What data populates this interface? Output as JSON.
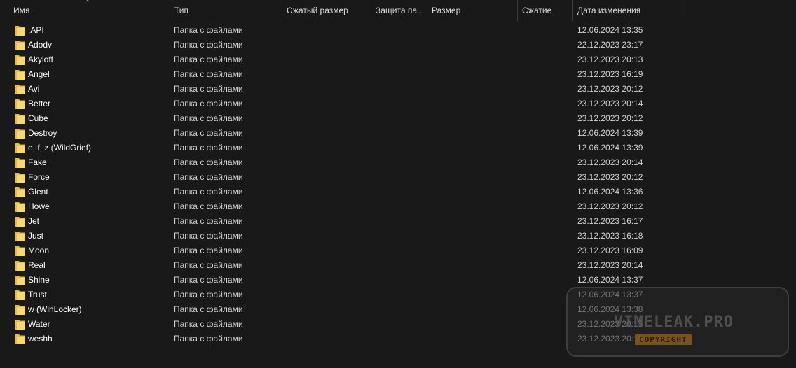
{
  "columns": {
    "name": "Имя",
    "type": "Тип",
    "compressed_size": "Сжатый размер",
    "protection": "Защита па...",
    "size": "Размер",
    "compression": "Сжатие",
    "modified": "Дата изменения"
  },
  "files": [
    {
      "name": ".API",
      "type": "Папка с файлами",
      "modified": "12.06.2024 13:35"
    },
    {
      "name": "Adodv",
      "type": "Папка с файлами",
      "modified": "22.12.2023 23:17"
    },
    {
      "name": "Akyloff",
      "type": "Папка с файлами",
      "modified": "23.12.2023 20:13"
    },
    {
      "name": "Angel",
      "type": "Папка с файлами",
      "modified": "23.12.2023 16:19"
    },
    {
      "name": "Avi",
      "type": "Папка с файлами",
      "modified": "23.12.2023 20:12"
    },
    {
      "name": "Better",
      "type": "Папка с файлами",
      "modified": "23.12.2023 20:14"
    },
    {
      "name": "Cube",
      "type": "Папка с файлами",
      "modified": "23.12.2023 20:12"
    },
    {
      "name": "Destroy",
      "type": "Папка с файлами",
      "modified": "12.06.2024 13:39"
    },
    {
      "name": "e, f, z (WildGrief)",
      "type": "Папка с файлами",
      "modified": "12.06.2024 13:39"
    },
    {
      "name": "Fake",
      "type": "Папка с файлами",
      "modified": "23.12.2023 20:14"
    },
    {
      "name": "Force",
      "type": "Папка с файлами",
      "modified": "23.12.2023 20:12"
    },
    {
      "name": "Glent",
      "type": "Папка с файлами",
      "modified": "12.06.2024 13:36"
    },
    {
      "name": "Howe",
      "type": "Папка с файлами",
      "modified": "23.12.2023 20:12"
    },
    {
      "name": "Jet",
      "type": "Папка с файлами",
      "modified": "23.12.2023 16:17"
    },
    {
      "name": "Just",
      "type": "Папка с файлами",
      "modified": "23.12.2023 16:18"
    },
    {
      "name": "Moon",
      "type": "Папка с файлами",
      "modified": "23.12.2023 16:09"
    },
    {
      "name": "Real",
      "type": "Папка с файлами",
      "modified": "23.12.2023 20:14"
    },
    {
      "name": "Shine",
      "type": "Папка с файлами",
      "modified": "12.06.2024 13:37"
    },
    {
      "name": "Trust",
      "type": "Папка с файлами",
      "modified": "12.06.2024 13:37"
    },
    {
      "name": "w (WinLocker)",
      "type": "Папка с файлами",
      "modified": "12.06.2024 13:38"
    },
    {
      "name": "Water",
      "type": "Папка с файлами",
      "modified": "23.12.2023 20:15"
    },
    {
      "name": "weshh",
      "type": "Папка с файлами",
      "modified": "23.12.2023 20:15"
    }
  ],
  "watermark": {
    "title": "VIMELEAK.PRO",
    "badge": "COPYRIGHT"
  },
  "icons": {
    "folder": "folder-icon",
    "sort": "sort-up-arrow-icon"
  },
  "colors": {
    "background": "#191919",
    "folder": "#f8d775",
    "text": "#ffffff",
    "secondary_text": "#d0d0d0"
  }
}
